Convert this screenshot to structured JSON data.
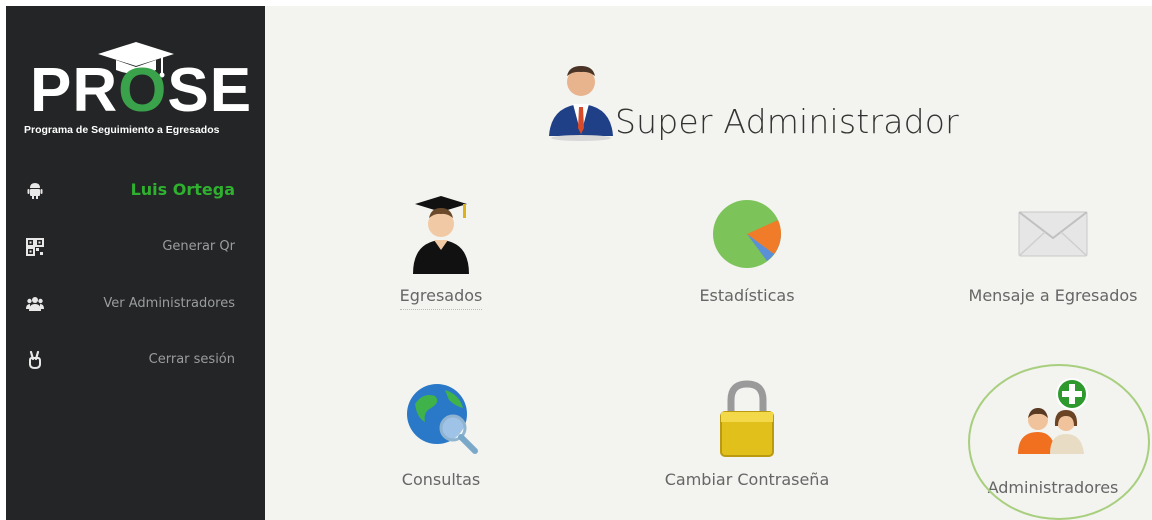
{
  "sidebar": {
    "logo": {
      "text_pr": "PR",
      "text_o": "O",
      "text_se": "SE",
      "tagline": "Programa de Seguimiento a Egresados"
    },
    "user": {
      "name": "Luis Ortega",
      "icon": "android-icon"
    },
    "items": [
      {
        "label": "Generar Qr",
        "icon": "qr-code-icon"
      },
      {
        "label": "Ver Administradores",
        "icon": "users-icon"
      },
      {
        "label": "Cerrar sesión",
        "icon": "peace-hand-icon"
      }
    ]
  },
  "main": {
    "title": "Super Administrador",
    "tiles": [
      {
        "label": "Egresados",
        "icon": "graduate-icon"
      },
      {
        "label": "Estadísticas",
        "icon": "pie-chart-icon"
      },
      {
        "label": "Mensaje a Egresados",
        "icon": "envelope-icon"
      },
      {
        "label": "Consultas",
        "icon": "globe-search-icon"
      },
      {
        "label": "Cambiar Contraseña",
        "icon": "padlock-icon"
      },
      {
        "label": "Administradores",
        "icon": "add-admin-icon"
      }
    ]
  },
  "colors": {
    "sidebar_bg": "#232526",
    "accent_green": "#2fb12f",
    "main_bg": "#f3f3f0"
  }
}
